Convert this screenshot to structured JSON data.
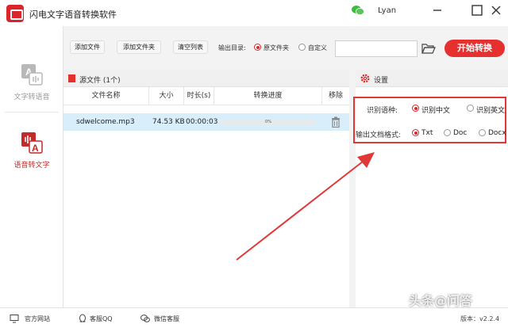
{
  "window": {
    "title": "闪电文字语音转换软件",
    "user": "Lyan"
  },
  "sidebar": {
    "items": [
      {
        "label": "文字转语音"
      },
      {
        "label": "语音转文字"
      }
    ]
  },
  "toolbar": {
    "add_file": "添加文件",
    "add_folder": "添加文件夹",
    "clear_list": "清空列表",
    "output_dir_label": "输出目录:",
    "output_source_folder": "原文件夹",
    "output_custom": "自定义",
    "path_value": "",
    "start_button": "开始转换"
  },
  "file_panel": {
    "title": "源文件 (1个)",
    "columns": [
      "文件名称",
      "大小",
      "时长(s)",
      "转换进度",
      "移除"
    ],
    "rows": [
      {
        "name": "sdwelcome.mp3",
        "size": "74.53 KB",
        "duration": "00:00:03",
        "progress_text": "0%",
        "progress": 0
      }
    ]
  },
  "settings": {
    "title": "设置",
    "language_label": "识别语种:",
    "language_options": [
      "识别中文",
      "识别英文"
    ],
    "language_selected": "识别中文",
    "format_label": "输出文档格式:",
    "format_options": [
      "Txt",
      "Doc",
      "Docx"
    ],
    "format_selected": "Txt"
  },
  "statusbar": {
    "website": "官方网站",
    "qq_service": "客服QQ",
    "wechat_service": "微信客服",
    "version": "版本：v2.2.4"
  },
  "watermark": "头条@问答",
  "colors": {
    "accent": "#e4302f",
    "selected_row": "#d9eefb",
    "highlight_box": "#e03838"
  }
}
